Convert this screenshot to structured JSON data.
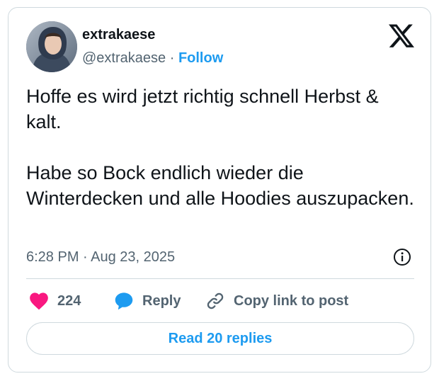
{
  "author": {
    "name": "extrakaese",
    "handle": "@extrakaese",
    "separator": "·",
    "follow_label": "Follow",
    "avatar_icon": "profile-photo-hooded-person"
  },
  "platform_icon": "x-logo-icon",
  "tweet": {
    "paragraphs": [
      "Hoffe es wird jetzt richtig schnell Herbst & kalt.",
      "Habe so Bock endlich wieder die Winterdecken und alle Hoodies auszupacken."
    ],
    "timestamp": "6:28 PM · Aug 23, 2025"
  },
  "actions": {
    "like_count": "224",
    "reply_label": "Reply",
    "copy_label": "Copy link to post"
  },
  "read_replies_label": "Read 20 replies",
  "colors": {
    "accent": "#1d9bf0",
    "like": "#f91880",
    "reply": "#1d9bf0",
    "text": "#0f1419",
    "muted": "#536471",
    "border": "#cfd9de"
  }
}
